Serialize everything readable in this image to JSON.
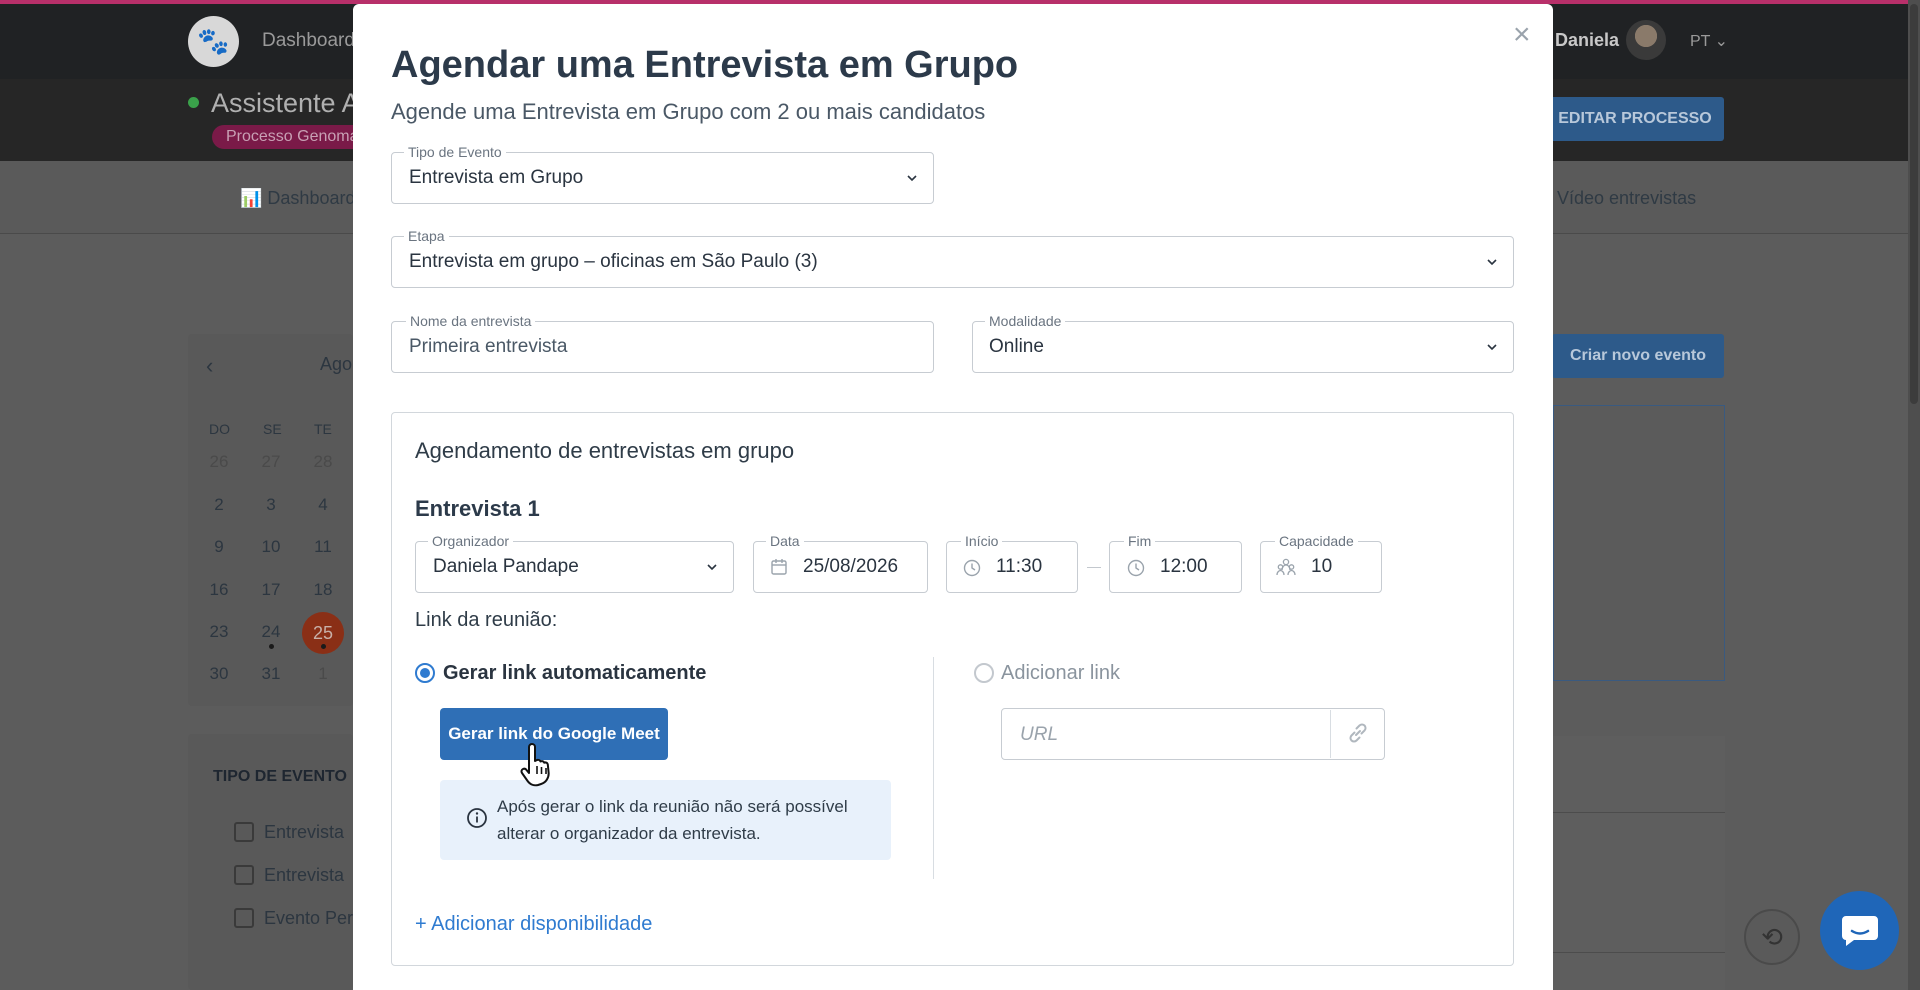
{
  "app": {
    "nav_dashboard": "Dashboard",
    "user_name": "Daniela",
    "language": "PT",
    "assistant_title": "Assistente A",
    "process_badge": "Processo Genoma",
    "edit_button": "EDITAR PROCESSO",
    "tab_dashboard": "Dashboard",
    "tab_video": "Vídeo entrevistas",
    "new_event_button": "Criar novo evento",
    "accent_color": "#2f7bd0",
    "brand_color": "#b8306a"
  },
  "calendar": {
    "prev": "‹",
    "month": "Ago",
    "weekdays": [
      "DO",
      "SE",
      "TE"
    ],
    "rows": [
      [
        "26",
        "27",
        "28"
      ],
      [
        "2",
        "3",
        "4"
      ],
      [
        "9",
        "10",
        "11"
      ],
      [
        "16",
        "17",
        "18"
      ],
      [
        "23",
        "24",
        "25"
      ],
      [
        "30",
        "31",
        "1"
      ]
    ],
    "today": "25"
  },
  "event_types": {
    "title": "TIPO DE EVENTO",
    "items": [
      "Entrevista",
      "Entrevista",
      "Evento Per"
    ]
  },
  "modal": {
    "close": "×",
    "title": "Agendar uma Entrevista em Grupo",
    "subtitle": "Agende uma Entrevista em Grupo com 2 ou mais candidatos",
    "event_type": {
      "label": "Tipo de Evento",
      "value": "Entrevista em Grupo"
    },
    "stage": {
      "label": "Etapa",
      "value": "Entrevista em grupo – oficinas em São Paulo (3)"
    },
    "interview_name": {
      "label": "Nome da entrevista",
      "value": "Primeira entrevista"
    },
    "modality": {
      "label": "Modalidade",
      "value": "Online"
    },
    "group_title": "Agendamento de entrevistas em grupo",
    "interview_title": "Entrevista 1",
    "organizer": {
      "label": "Organizador",
      "value": "Daniela Pandape"
    },
    "date": {
      "label": "Data",
      "value": "25/08/2026"
    },
    "start": {
      "label": "Início",
      "value": "11:30"
    },
    "end": {
      "label": "Fim",
      "value": "12:00"
    },
    "capacity": {
      "label": "Capacidade",
      "value": "10"
    },
    "meeting_link_label": "Link da reunião:",
    "radio_auto": "Gerar link automaticamente",
    "radio_add": "Adicionar link",
    "meet_button": "Gerar link do Google Meet",
    "info_text": "Após gerar o link da reunião não será possível alterar o organizador da entrevista.",
    "url_placeholder": "URL",
    "add_availability": "+ Adicionar disponibilidade"
  }
}
